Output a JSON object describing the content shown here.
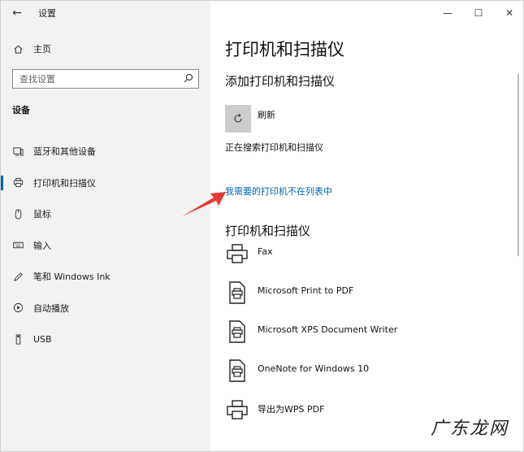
{
  "window": {
    "title": "设置",
    "controls": {
      "minimize": "—",
      "maximize": "☐",
      "close": "✕"
    }
  },
  "sidebar": {
    "home_label": "主页",
    "search_placeholder": "查找设置",
    "section_title": "设备",
    "items": [
      {
        "label": "蓝牙和其他设备",
        "icon": "bluetooth-devices-icon"
      },
      {
        "label": "打印机和扫描仪",
        "icon": "printer-icon",
        "selected": true
      },
      {
        "label": "鼠标",
        "icon": "mouse-icon"
      },
      {
        "label": "输入",
        "icon": "keyboard-icon"
      },
      {
        "label": "笔和 Windows Ink",
        "icon": "pen-icon"
      },
      {
        "label": "自动播放",
        "icon": "autoplay-icon"
      },
      {
        "label": "USB",
        "icon": "usb-icon"
      }
    ]
  },
  "content": {
    "page_title": "打印机和扫描仪",
    "add_section_title": "添加打印机和扫描仪",
    "refresh_label": "刷新",
    "searching_status": "正在搜索打印机和扫描仪",
    "missing_printer_link": "我需要的打印机不在列表中",
    "list_section_title": "打印机和扫描仪",
    "printers": [
      {
        "name": "Fax",
        "icon": "fax-printer-icon"
      },
      {
        "name": "Microsoft Print to PDF",
        "icon": "document-printer-icon"
      },
      {
        "name": "Microsoft XPS Document Writer",
        "icon": "document-printer-icon"
      },
      {
        "name": "OneNote for Windows 10",
        "icon": "document-printer-icon"
      },
      {
        "name": "导出为WPS PDF",
        "icon": "printer-icon"
      }
    ]
  },
  "watermark": "广东龙网",
  "colors": {
    "accent": "#0063b1",
    "sidebar_bg": "#f2f2f2",
    "annotation_arrow": "#e53935"
  }
}
